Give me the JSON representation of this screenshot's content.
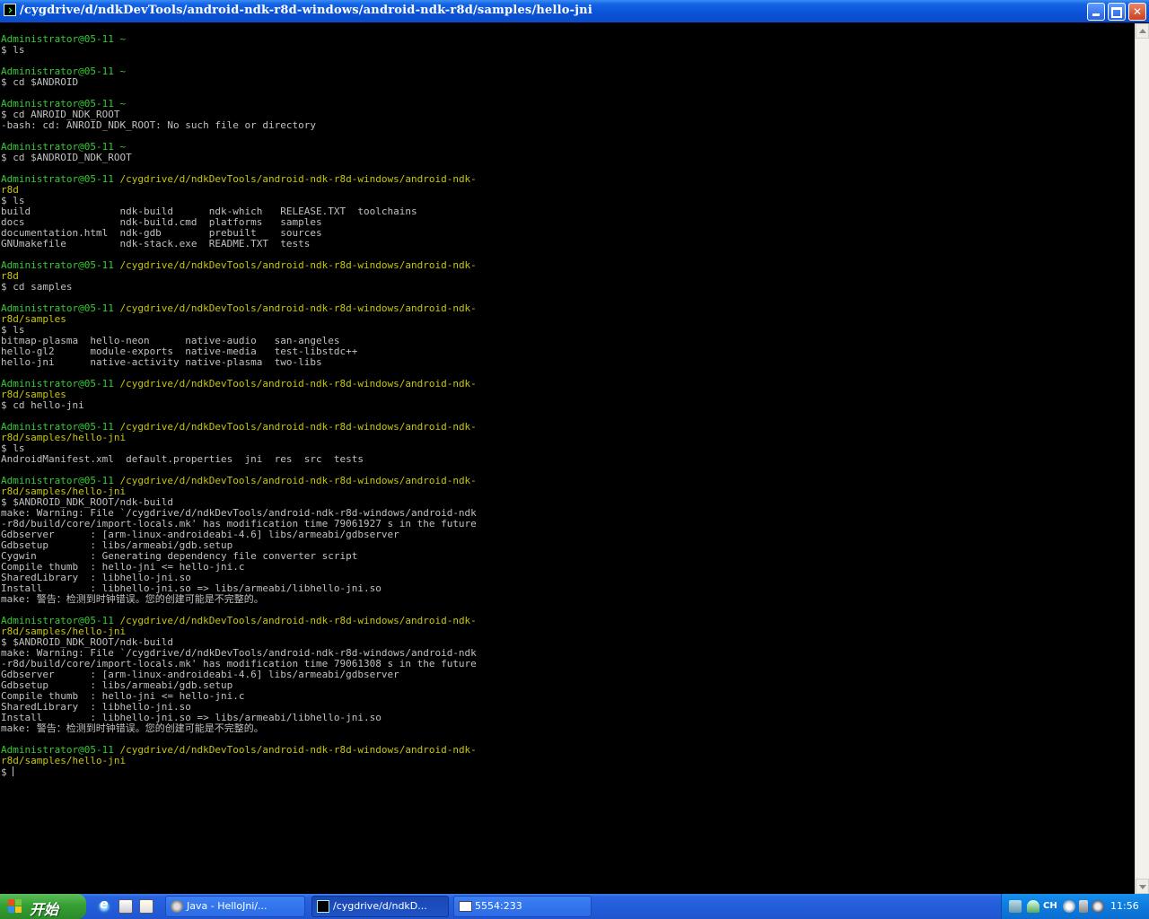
{
  "window": {
    "title": "/cygdrive/d/ndkDevTools/android-ndk-r8d-windows/android-ndk-r8d/samples/hello-jni",
    "minimize": "minimize",
    "maximize": "restore",
    "close": "close"
  },
  "terminal": {
    "lines": [
      {
        "t": "Administrator@05-11 ~",
        "c": "p"
      },
      {
        "t": "$ ls"
      },
      {
        "t": ""
      },
      {
        "t": "Administrator@05-11 ~",
        "c": "p"
      },
      {
        "t": "$ cd $ANDROID"
      },
      {
        "t": ""
      },
      {
        "t": "Administrator@05-11 ~",
        "c": "p"
      },
      {
        "t": "$ cd ANROID_NDK_ROOT"
      },
      {
        "t": "-bash: cd: ANROID_NDK_ROOT: No such file or directory"
      },
      {
        "t": ""
      },
      {
        "t": "Administrator@05-11 ~",
        "c": "p"
      },
      {
        "t": "$ cd $ANDROID_NDK_ROOT"
      },
      {
        "t": ""
      },
      {
        "t": "Administrator@05-11 ",
        "c": "p",
        "y": "/cygdrive/d/ndkDevTools/android-ndk-r8d-windows/android-ndk-"
      },
      {
        "t": "",
        "y": "r8d"
      },
      {
        "t": "$ ls"
      },
      {
        "t": "build               ndk-build      ndk-which   RELEASE.TXT  toolchains"
      },
      {
        "t": "docs                ndk-build.cmd  platforms   samples"
      },
      {
        "t": "documentation.html  ndk-gdb        prebuilt    sources"
      },
      {
        "t": "GNUmakefile         ndk-stack.exe  README.TXT  tests"
      },
      {
        "t": ""
      },
      {
        "t": "Administrator@05-11 ",
        "c": "p",
        "y": "/cygdrive/d/ndkDevTools/android-ndk-r8d-windows/android-ndk-"
      },
      {
        "t": "",
        "y": "r8d"
      },
      {
        "t": "$ cd samples"
      },
      {
        "t": ""
      },
      {
        "t": "Administrator@05-11 ",
        "c": "p",
        "y": "/cygdrive/d/ndkDevTools/android-ndk-r8d-windows/android-ndk-"
      },
      {
        "t": "",
        "y": "r8d/samples"
      },
      {
        "t": "$ ls"
      },
      {
        "t": "bitmap-plasma  hello-neon      native-audio   san-angeles"
      },
      {
        "t": "hello-gl2      module-exports  native-media   test-libstdc++"
      },
      {
        "t": "hello-jni      native-activity native-plasma  two-libs"
      },
      {
        "t": ""
      },
      {
        "t": "Administrator@05-11 ",
        "c": "p",
        "y": "/cygdrive/d/ndkDevTools/android-ndk-r8d-windows/android-ndk-"
      },
      {
        "t": "",
        "y": "r8d/samples"
      },
      {
        "t": "$ cd hello-jni"
      },
      {
        "t": ""
      },
      {
        "t": "Administrator@05-11 ",
        "c": "p",
        "y": "/cygdrive/d/ndkDevTools/android-ndk-r8d-windows/android-ndk-"
      },
      {
        "t": "",
        "y": "r8d/samples/hello-jni"
      },
      {
        "t": "$ ls"
      },
      {
        "t": "AndroidManifest.xml  default.properties  jni  res  src  tests"
      },
      {
        "t": ""
      },
      {
        "t": "Administrator@05-11 ",
        "c": "p",
        "y": "/cygdrive/d/ndkDevTools/android-ndk-r8d-windows/android-ndk-"
      },
      {
        "t": "",
        "y": "r8d/samples/hello-jni"
      },
      {
        "t": "$ $ANDROID_NDK_ROOT/ndk-build"
      },
      {
        "t": "make: Warning: File `/cygdrive/d/ndkDevTools/android-ndk-r8d-windows/android-ndk"
      },
      {
        "t": "-r8d/build/core/import-locals.mk' has modification time 79061927 s in the future"
      },
      {
        "t": "Gdbserver      : [arm-linux-androideabi-4.6] libs/armeabi/gdbserver"
      },
      {
        "t": "Gdbsetup       : libs/armeabi/gdb.setup"
      },
      {
        "t": "Cygwin         : Generating dependency file converter script"
      },
      {
        "t": "Compile thumb  : hello-jni <= hello-jni.c"
      },
      {
        "t": "SharedLibrary  : libhello-jni.so"
      },
      {
        "t": "Install        : libhello-jni.so => libs/armeabi/libhello-jni.so"
      },
      {
        "t": "make: 警告：检测到时钟错误。您的创建可能是不完整的。"
      },
      {
        "t": ""
      },
      {
        "t": "Administrator@05-11 ",
        "c": "p",
        "y": "/cygdrive/d/ndkDevTools/android-ndk-r8d-windows/android-ndk-"
      },
      {
        "t": "",
        "y": "r8d/samples/hello-jni"
      },
      {
        "t": "$ $ANDROID_NDK_ROOT/ndk-build"
      },
      {
        "t": "make: Warning: File `/cygdrive/d/ndkDevTools/android-ndk-r8d-windows/android-ndk"
      },
      {
        "t": "-r8d/build/core/import-locals.mk' has modification time 79061308 s in the future"
      },
      {
        "t": "Gdbserver      : [arm-linux-androideabi-4.6] libs/armeabi/gdbserver"
      },
      {
        "t": "Gdbsetup       : libs/armeabi/gdb.setup"
      },
      {
        "t": "Compile thumb  : hello-jni <= hello-jni.c"
      },
      {
        "t": "SharedLibrary  : libhello-jni.so"
      },
      {
        "t": "Install        : libhello-jni.so => libs/armeabi/libhello-jni.so"
      },
      {
        "t": "make: 警告：检测到时钟错误。您的创建可能是不完整的。"
      },
      {
        "t": ""
      },
      {
        "t": "Administrator@05-11 ",
        "c": "p",
        "y": "/cygdrive/d/ndkDevTools/android-ndk-r8d-windows/android-ndk-"
      },
      {
        "t": "",
        "y": "r8d/samples/hello-jni"
      },
      {
        "t": "$ ",
        "cursor": true
      }
    ]
  },
  "taskbar": {
    "start_label": "开始",
    "quick_launch": [
      "ie-icon",
      "desktop-icon",
      "editor-icon"
    ],
    "tasks": [
      {
        "label": "Java - HelloJni/...",
        "icon": "eclipse-icon"
      },
      {
        "label": "/cygdrive/d/ndkD...",
        "icon": "terminal-icon",
        "active": true
      },
      {
        "label": "5554:233",
        "icon": "window-icon"
      }
    ],
    "tray": {
      "lang": "CH",
      "clock": "11:56"
    }
  },
  "colors": {
    "prompt": "#33cc33",
    "path": "#c8c800",
    "text": "#c0c0c0",
    "titlebar": "#0a52d6",
    "taskbar": "#245ddb",
    "start": "#35a033"
  }
}
